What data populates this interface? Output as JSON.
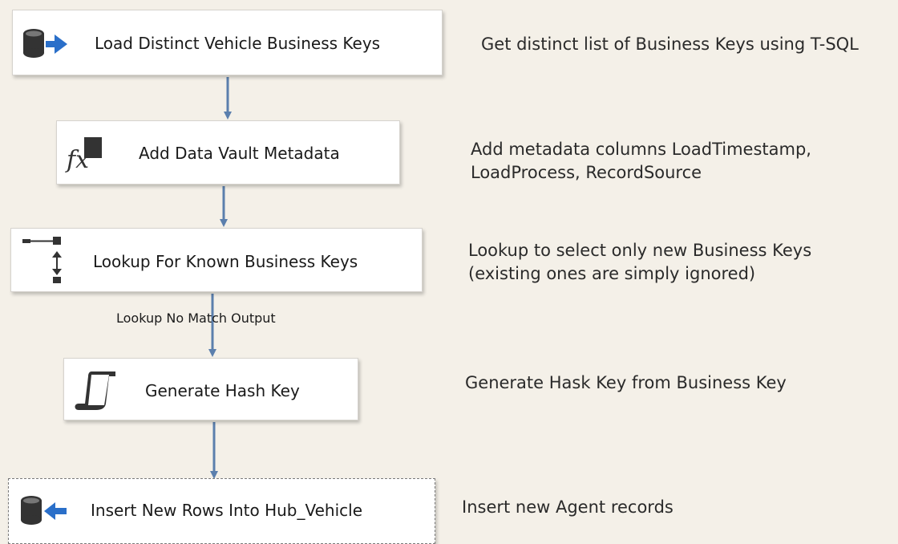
{
  "tasks": [
    {
      "label": "Load Distinct Vehicle Business Keys",
      "icon": "ole-db-source-icon"
    },
    {
      "label": "Add Data Vault Metadata",
      "icon": "derived-column-icon"
    },
    {
      "label": "Lookup For Known Business Keys",
      "icon": "lookup-icon"
    },
    {
      "label": "Generate Hash Key",
      "icon": "script-component-icon"
    },
    {
      "label": "Insert New Rows Into Hub_Vehicle",
      "icon": "ole-db-destination-icon"
    }
  ],
  "notes": [
    {
      "lines": [
        "Get distinct list of Business Keys using T-SQL"
      ]
    },
    {
      "lines": [
        "Add metadata columns LoadTimestamp,",
        "LoadProcess, RecordSource"
      ]
    },
    {
      "lines": [
        "Lookup to select only new Business Keys",
        "(existing ones are simply ignored)"
      ]
    },
    {
      "lines": [
        "Generate Hask Key from Business Key"
      ]
    },
    {
      "lines": [
        "Insert new Agent records"
      ]
    }
  ],
  "path_labels": {
    "lookup_output": "Lookup No Match Output"
  },
  "colors": {
    "canvas": "#f4f0e8",
    "arrow": "#5b7fad",
    "db_icon": "#333333",
    "source_arrow": "#2a6fc9"
  }
}
